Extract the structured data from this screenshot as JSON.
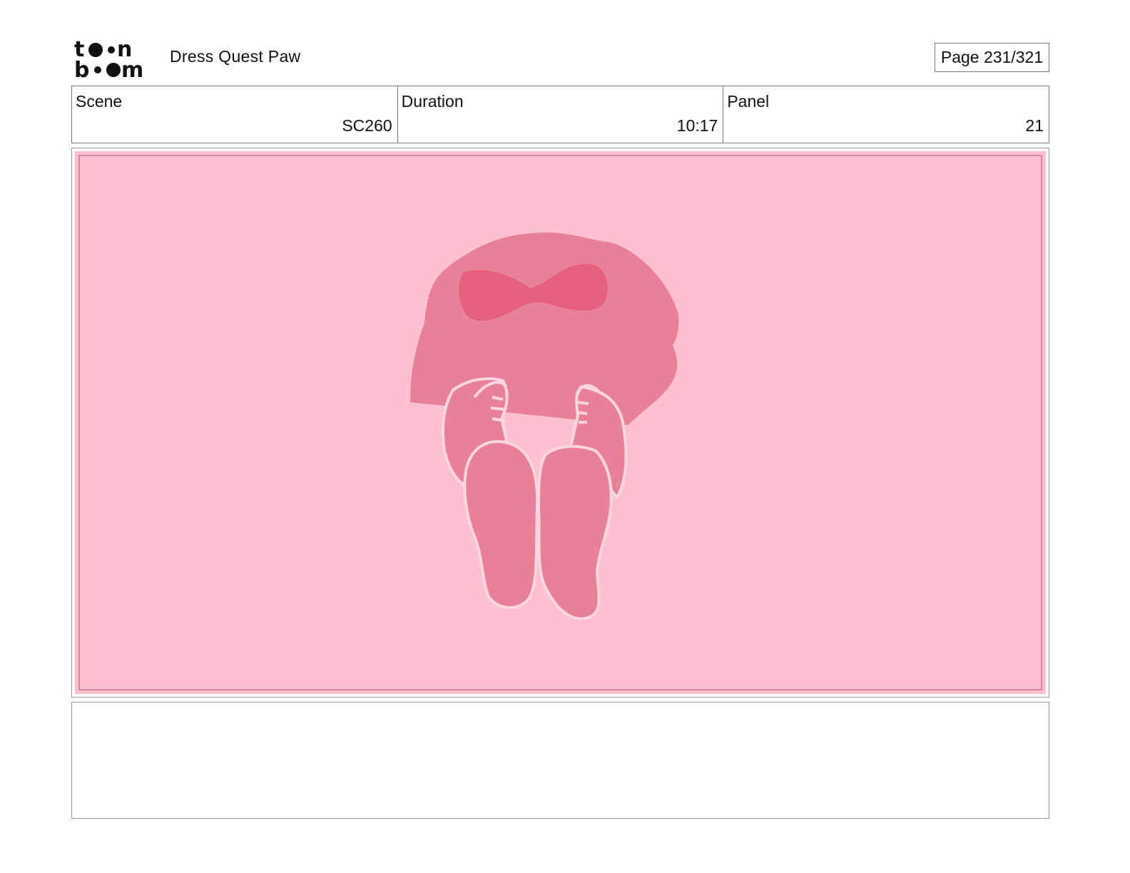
{
  "header": {
    "logo_name": "toonboom-logo",
    "project_title": "Dress Quest Paw",
    "page_label": "Page 231/321"
  },
  "info": {
    "scene_label": "Scene",
    "scene_value": "SC260",
    "duration_label": "Duration",
    "duration_value": "10:17",
    "panel_label": "Panel",
    "panel_value": "21"
  },
  "panel": {
    "background_color": "#fcc0ce",
    "figure_color": "#e88197",
    "bow_color": "#e55f7f"
  },
  "notes": {
    "text": ""
  }
}
